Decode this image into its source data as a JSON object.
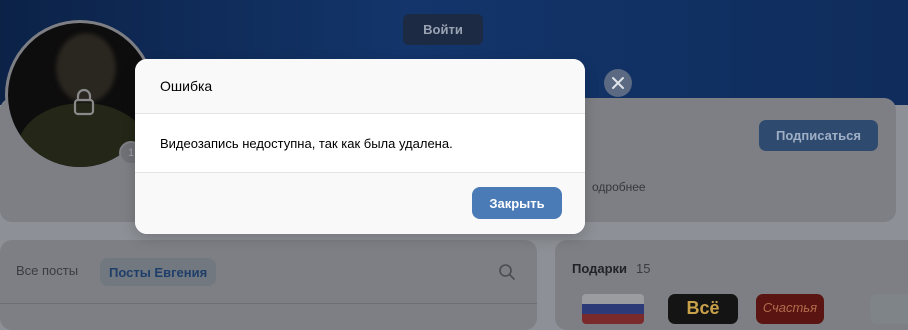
{
  "header": {
    "login_label": "Войти"
  },
  "profile": {
    "subscribe_label": "Подписаться",
    "more_label": "одробнее",
    "avatar_badge": "1"
  },
  "posts": {
    "tabs": [
      {
        "label": "Все посты",
        "active": false
      },
      {
        "label": "Посты Евгения",
        "active": true
      }
    ]
  },
  "gifts": {
    "title": "Подарки",
    "count": "15",
    "items": [
      {
        "name": "flag-gift"
      },
      {
        "name": "vse-gift",
        "text": "Всё"
      },
      {
        "name": "red-gift",
        "text": "Счастья"
      },
      {
        "name": "partial-gift"
      }
    ]
  },
  "modal": {
    "title": "Ошибка",
    "message": "Видеозапись недоступна, так как была удалена.",
    "close_label": "Закрыть"
  },
  "icons": {
    "overlay_close": "close-icon",
    "avatar_lock": "lock-icon",
    "posts_search": "search-icon"
  },
  "colors": {
    "primary_button": "#4a7bb7",
    "overlay_dim": "#8d9096"
  }
}
